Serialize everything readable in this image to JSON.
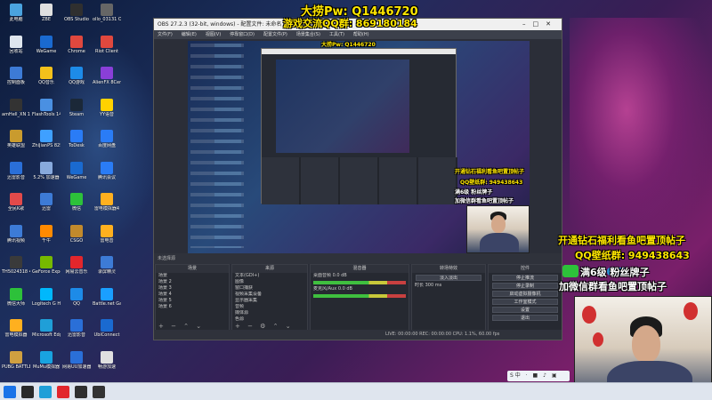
{
  "desktop": {
    "col1": [
      {
        "label": "此电脑",
        "color": "#4aa3df"
      },
      {
        "label": "回收站",
        "color": "#dfe6ee"
      },
      {
        "label": "控制面板",
        "color": "#3d7bd6"
      },
      {
        "label": "amHell_XN 14",
        "color": "#333"
      },
      {
        "label": "英雄联盟",
        "color": "#c99b2e"
      },
      {
        "label": "迅雷影音",
        "color": "#2a6fd8"
      },
      {
        "label": "全民K歌",
        "color": "#e24a4a"
      },
      {
        "label": "腾讯视频",
        "color": "#3d7bd6"
      },
      {
        "label": "TH5024318 49WM71",
        "color": "#3a3a3a"
      },
      {
        "label": "微信大师",
        "color": "#2dc13a"
      },
      {
        "label": "雷电模拟器",
        "color": "#ffb01f"
      },
      {
        "label": "PUBG BATTLEGROUNDS",
        "color": "#d0a040"
      },
      {
        "label": "夜神模拟器",
        "color": "#e0e0e0"
      }
    ],
    "col2": [
      {
        "label": "ZBE",
        "color": "#e0e0e0"
      },
      {
        "label": "WeGame",
        "color": "#1a6ad0"
      },
      {
        "label": "QQ音乐",
        "color": "#f3c11b"
      },
      {
        "label": "FlashTools 14",
        "color": "#4a90e2"
      },
      {
        "label": "ZhiJianPS 825a1d2",
        "color": "#3fa0ff"
      },
      {
        "label": "5.2% 加速器",
        "color": "#8ad"
      },
      {
        "label": "迅雷",
        "color": "#3d7bd6"
      },
      {
        "label": "千牛",
        "color": "#ff8a00"
      },
      {
        "label": "GeForce Experience",
        "color": "#76b900"
      },
      {
        "label": "Logitech G HUB",
        "color": "#00b8fc"
      },
      {
        "label": "Microsoft Edge",
        "color": "#1f9fd8"
      },
      {
        "label": "MuMu模拟器",
        "color": "#19a3e0"
      },
      {
        "label": "MuMu助手",
        "color": "#19a3e0"
      }
    ],
    "col3": [
      {
        "label": "OBS Studio",
        "color": "#2f2f2f"
      },
      {
        "label": "Chrome",
        "color": "#e0483e"
      },
      {
        "label": "QQ游戏",
        "color": "#1d8be8"
      },
      {
        "label": "Steam",
        "color": "#1b2838"
      },
      {
        "label": "ToDesk",
        "color": "#2a7cf6"
      },
      {
        "label": "WeGame",
        "color": "#1a6ad0"
      },
      {
        "label": "微信",
        "color": "#2dc13a"
      },
      {
        "label": "CSGO",
        "color": "#c28a2c"
      },
      {
        "label": "网易云音乐",
        "color": "#e2262c"
      },
      {
        "label": "QQ",
        "color": "#1d8be8"
      },
      {
        "label": "迅雷影音",
        "color": "#2a6fd8"
      },
      {
        "label": "网易UU加速器",
        "color": "#2a6fd8"
      },
      {
        "label": "网易云音乐",
        "color": "#e2262c"
      }
    ],
    "col4": [
      {
        "label": "ollo_03131 OP CX11C",
        "color": "#666"
      },
      {
        "label": "Riot Client",
        "color": "#e0483e"
      },
      {
        "label": "AlienFX 8Central",
        "color": "#8a3fd8"
      },
      {
        "label": "YY语音",
        "color": "#ffd200"
      },
      {
        "label": "百度网盘",
        "color": "#2a7cf6"
      },
      {
        "label": "腾讯会议",
        "color": "#2a7cf6"
      },
      {
        "label": "雷电模拟器4",
        "color": "#ffb01f"
      },
      {
        "label": "雷电音",
        "color": "#ffb01f"
      },
      {
        "label": "录屏精灵",
        "color": "#3d7bd6"
      },
      {
        "label": "Battle.net Game",
        "color": "#1a9fff"
      },
      {
        "label": "UbiConnect",
        "color": "#1a6ad0"
      },
      {
        "label": "畅游加速",
        "color": "#e0e0e0"
      },
      {
        "label": "",
        "color": "transparent"
      }
    ]
  },
  "obs": {
    "title": "OBS 27.2.3 (32-bit, windows) - 配置文件: 未命名 - 场景: 未命名",
    "menu": [
      "文件(F)",
      "编辑(E)",
      "视图(V)",
      "停靠窗口(D)",
      "配置文件(P)",
      "场景集合(S)",
      "工具(T)",
      "帮助(H)"
    ],
    "status_strip": "未选择源",
    "scenes_header": "场景",
    "scenes": [
      "场景",
      "场景 2",
      "场景 3",
      "场景 4",
      "场景 5",
      "场景 6"
    ],
    "sources_header": "来源",
    "sources": [
      "文本(GDI+)",
      "图像",
      "窗口捕获",
      "视频采集设备",
      "显示器采集",
      "音频",
      "媒体源",
      "色源",
      "浏览器",
      "游戏采集",
      "图像幻灯片",
      "显示器采集"
    ],
    "mixer_header": "混音器",
    "mixer_tracks": [
      {
        "name": "桌面音频",
        "level": "0.0 dB"
      },
      {
        "name": "麦克风/Aux",
        "level": "0.0 dB"
      }
    ],
    "transitions_header": "转场特效",
    "transition": "淡入淡出",
    "duration": "300 ms",
    "controls_header": "控件",
    "controls": [
      "停止推流",
      "停止录制",
      "启动虚拟摄像机",
      "工作室模式",
      "设置",
      "退出"
    ],
    "status_bar": "LIVE: 00:00:00   REC: 00:00:00   CPU: 1.1%, 60.00 fps"
  },
  "overlays": {
    "top_name": "大捞Pw: Q1446720",
    "top_group": "游戏交流QQ群: 869180184",
    "right_line1": "开通钻石福利看鱼吧置顶帖子",
    "right_line2": "QQ壁纸群: 949438643",
    "right_line3": "满6级  粉丝牌子",
    "right_line4": "加微信群看鱼吧置顶帖子",
    "inner_line1": "开通钻石福利看鱼吧置顶帖子",
    "inner_line2": "QQ壁纸群: 949438643",
    "inner_line3": "满6级  粉丝牌子",
    "inner_line4": "加微信群看鱼吧置顶帖子",
    "inner_top_name": "大捞Pw: Q1446720"
  },
  "taskbar": {
    "items": [
      {
        "name": "start-icon",
        "color": "#1a73e8"
      },
      {
        "name": "search-icon",
        "color": "#2a2a2a"
      },
      {
        "name": "edge-icon",
        "color": "#1f9fd8"
      },
      {
        "name": "netease-icon",
        "color": "#e2262c"
      },
      {
        "name": "obs-icon",
        "color": "#2f2f2f"
      },
      {
        "name": "app-icon",
        "color": "#333"
      }
    ],
    "tray": "S中 ·  ■ ♪ ▣"
  }
}
